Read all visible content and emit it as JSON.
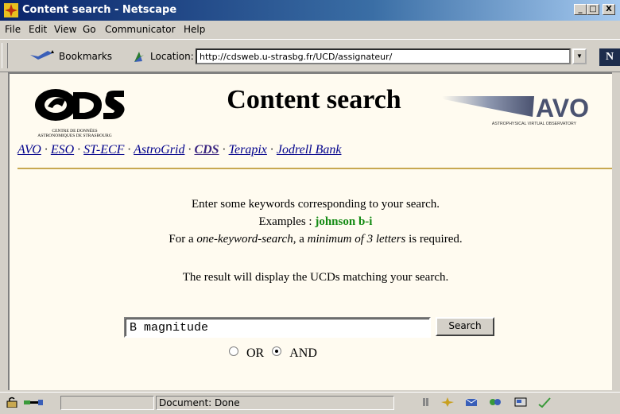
{
  "window": {
    "title": "Content search - Netscape",
    "minimize": "_",
    "maximize": "□",
    "close": "X"
  },
  "menu": [
    "File",
    "Edit",
    "View",
    "Go",
    "Communicator",
    "Help"
  ],
  "toolbar": {
    "bookmarks": "Bookmarks",
    "location_label": "Location:",
    "url": "http://cdsweb.u-strasbg.fr/UCD/assignateur/"
  },
  "page": {
    "title": "Content search",
    "cds_logo_subtitle": [
      "CENTRE DE DONNÉES",
      "ASTRONOMIQUES DE STRASBOURG"
    ],
    "avo_logo_text": "AVO",
    "avo_logo_subtitle": "ASTROPHYSICAL VIRTUAL OBSERVATORY",
    "nav": [
      "AVO",
      "ESO",
      "ST-ECF",
      "AstroGrid",
      "CDS",
      "Terapix",
      "Jodrell Bank"
    ],
    "line1": "Enter some keywords corresponding to your search.",
    "examples_prefix": "Examples :",
    "examples_value": "johnson b-i",
    "line3_a": "For a ",
    "line3_b": "one-keyword-search",
    "line3_c": ", a ",
    "line3_d": "minimum of 3 letters",
    "line3_e": " is required.",
    "line4": "The result will display the UCDs matching your search.",
    "search_value": "B magnitude",
    "search_button": "Search",
    "radio_or": "OR",
    "radio_and": "AND"
  },
  "status": {
    "text": "Document: Done"
  },
  "colors": {
    "title_bar": "#0a246a",
    "page_bg": "#fffbf0",
    "link": "#00008b",
    "example": "#138a13",
    "rule": "#c8a850"
  }
}
